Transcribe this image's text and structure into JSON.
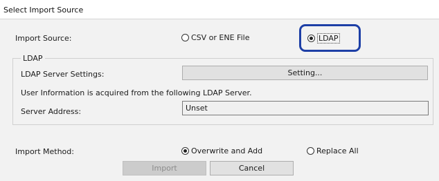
{
  "window": {
    "title": "Select Import Source"
  },
  "import_source": {
    "label": "Import Source:",
    "options": [
      {
        "label": "CSV or ENE File",
        "selected": false
      },
      {
        "label": "LDAP",
        "selected": true
      }
    ]
  },
  "ldap_group": {
    "title": "LDAP",
    "server_settings_label": "LDAP Server Settings:",
    "setting_button": "Setting...",
    "info_text": "User Information is acquired from the following LDAP Server.",
    "server_address_label": "Server Address:",
    "server_address_value": "Unset"
  },
  "import_method": {
    "label": "Import Method:",
    "options": [
      {
        "label": "Overwrite and Add",
        "selected": true
      },
      {
        "label": "Replace All",
        "selected": false
      }
    ]
  },
  "buttons": {
    "import": "Import",
    "cancel": "Cancel"
  },
  "colors": {
    "highlight": "#1d3fa6",
    "background": "#f2f2f2"
  }
}
